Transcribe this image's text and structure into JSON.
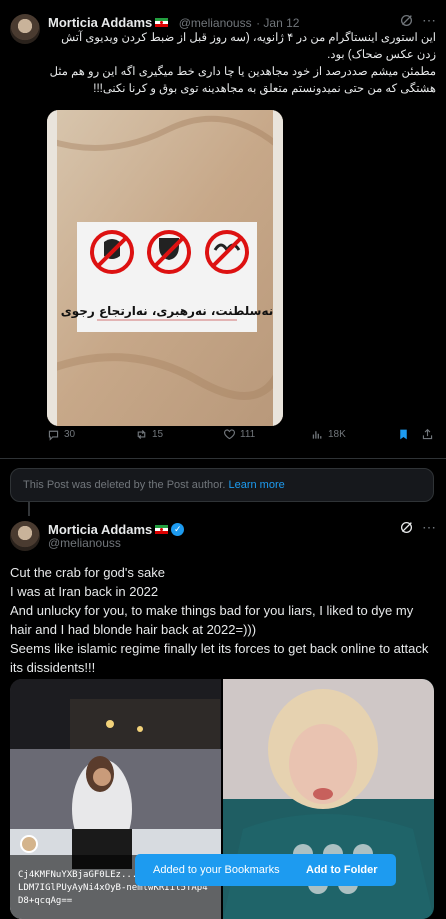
{
  "post1": {
    "name": "Morticia Addams",
    "handle": "@melianouss",
    "date": "Jan 12",
    "text_line1": "این استوری اینستاگرام من در ۴ ژانویه، (سه روز قبل از ضبط کردن ویدیوی آتش زدن عکس ضحاک) بود.",
    "text_line2": "مطمئن میشم صددرصد از خود مجاهدین یا چا داری خط میگیری اگه این رو هم مثل هشتگی که من حتی نمیدونستم متعلق به مجاهدینه توی بوق و کرنا نکنی!!!",
    "poster_text": "نەسلطنت، نەرهبری، نەارتجاع رجوی",
    "replies": "30",
    "reposts": "15",
    "likes": "111",
    "views": "18K"
  },
  "deleted_notice": {
    "text": "This Post was deleted by the Post author.",
    "link": "Learn more"
  },
  "post2": {
    "name": "Morticia Addams",
    "handle": "@melianouss",
    "lines": [
      "Cut the crab for god's sake",
      "I was at Iran back in 2022",
      "And unlucky for you, to make things bad for you liars, I liked to dye my hair and I had blonde hair back at 2022=)))",
      "Seems like islamic regime finally let its forces to get back online to attack its dissidents!!!"
    ],
    "photo_caption": "Cj4KMFNuYXBjaGF0LEz... KGIQaG9uZTE3LDM7IGlPUyAyNi4xOyB-nemlwKRIil5TAp4D8+qcqAg=="
  },
  "toast": {
    "message": "Added to your Bookmarks",
    "action": "Add to Folder"
  },
  "colors": {
    "accent": "#1d9bf0",
    "bookmark": "#1d9bf0",
    "bg": "#000000"
  }
}
